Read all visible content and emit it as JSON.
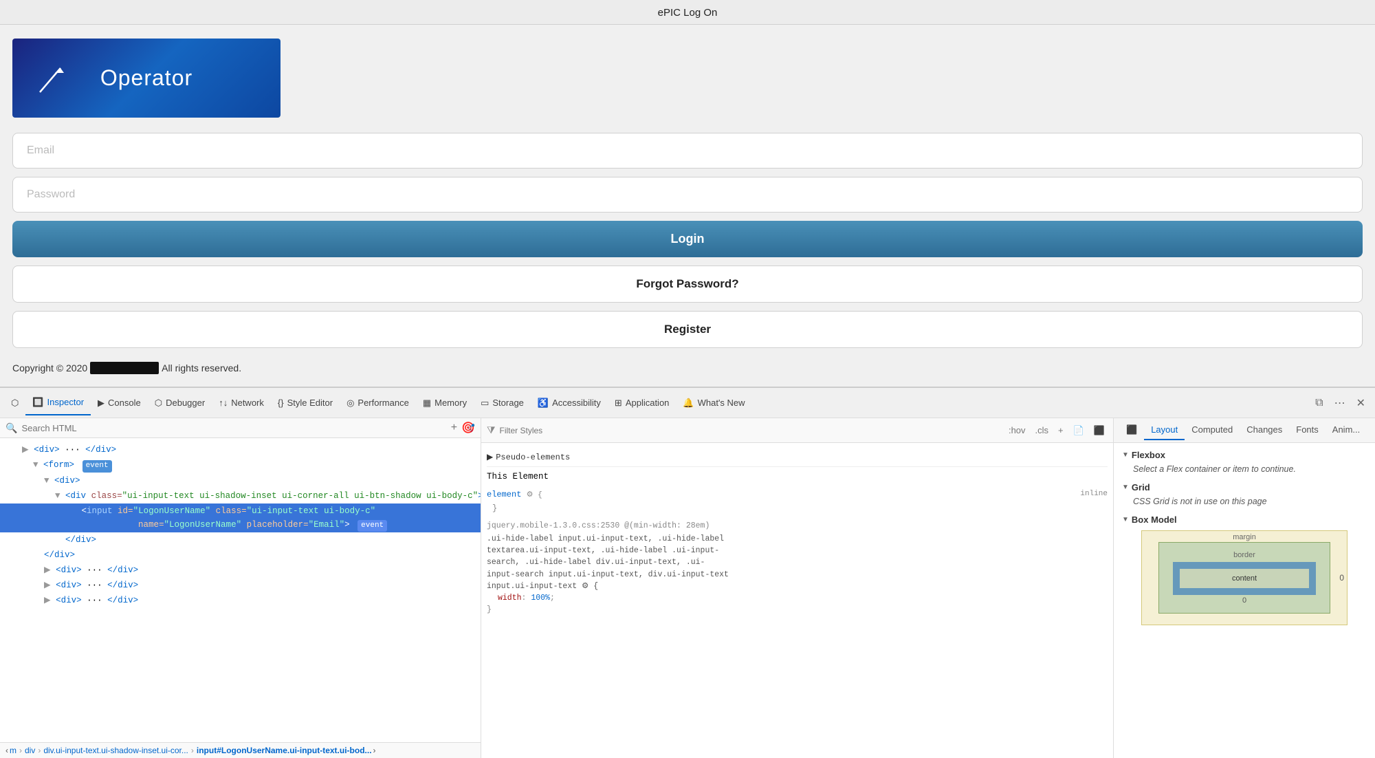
{
  "titleBar": {
    "title": "ePIC Log On"
  },
  "page": {
    "logo": {
      "text": "Operator"
    },
    "emailPlaceholder": "Email",
    "passwordPlaceholder": "Password",
    "loginButton": "Login",
    "forgotButton": "Forgot Password?",
    "registerButton": "Register",
    "copyright": "Copyright © 2020",
    "copyrightSuffix": "All rights reserved."
  },
  "devtools": {
    "tools": [
      {
        "id": "picker",
        "label": "",
        "icon": "⬡",
        "active": false
      },
      {
        "id": "inspector",
        "label": "Inspector",
        "icon": "🔲",
        "active": true
      },
      {
        "id": "console",
        "label": "Console",
        "icon": "▶",
        "active": false
      },
      {
        "id": "debugger",
        "label": "Debugger",
        "icon": "⬡",
        "active": false
      },
      {
        "id": "network",
        "label": "Network",
        "icon": "↑↓",
        "active": false
      },
      {
        "id": "style-editor",
        "label": "Style Editor",
        "icon": "{}",
        "active": false
      },
      {
        "id": "performance",
        "label": "Performance",
        "icon": "◎",
        "active": false
      },
      {
        "id": "memory",
        "label": "Memory",
        "icon": "▦",
        "active": false
      },
      {
        "id": "storage",
        "label": "Storage",
        "icon": "▭",
        "active": false
      },
      {
        "id": "accessibility",
        "label": "Accessibility",
        "icon": "♿",
        "active": false
      },
      {
        "id": "application",
        "label": "Application",
        "icon": "⊞",
        "active": false
      },
      {
        "id": "whats-new",
        "label": "What's New",
        "icon": "🔔",
        "active": false
      }
    ],
    "searchHtml": {
      "placeholder": "Search HTML"
    },
    "htmlCode": [
      {
        "indent": 4,
        "text": "▶ <div> ··· </div>",
        "selected": false
      },
      {
        "indent": 6,
        "text": "▼ <form>",
        "badge": "event",
        "selected": false
      },
      {
        "indent": 8,
        "text": "▼ <div>",
        "selected": false
      },
      {
        "indent": 10,
        "text": "▼ <div class=\"ui-input-text ui-shadow-inset ui-corner-all ui-btn-shadow ui-body-c\">",
        "selected": false
      },
      {
        "indent": 12,
        "text": "<input id=\"LogonUserName\" class=\"ui-input-text ui-body-c\"",
        "selected": true,
        "continuation": "name=\"LogonUserName\" placeholder=\"Email\">",
        "badge": "event"
      },
      {
        "indent": 12,
        "text": "</div>",
        "selected": false
      },
      {
        "indent": 10,
        "text": "</div>",
        "selected": false
      },
      {
        "indent": 8,
        "text": "▶ <div> ··· </div>",
        "selected": false
      },
      {
        "indent": 8,
        "text": "▶ <div> ··· </div>",
        "selected": false
      },
      {
        "indent": 8,
        "text": "▶ <div> ··· </div>",
        "selected": false
      }
    ],
    "breadcrumb": [
      "m",
      "div",
      "div.ui-input-text.ui-shadow-inset.ui-cor...",
      "input#LogonUserName.ui-input-text.ui-bod..."
    ],
    "cssPanel": {
      "filterPlaceholder": "Filter Styles",
      "pseudoElements": "Pseudo-elements",
      "thisElement": "This Element",
      "elementRule": "element",
      "inline": "inline",
      "cssSource": "jquery.mobile-1.3.0.css:2530 @(min-width: 28em)",
      "cssSelector": ".ui-hide-label input.ui-input-text, .ui-hide-label textarea.ui-input-text, .ui-hide-label .ui-input-search, .ui-hide-label div.ui-input-text, .ui-input-search input.ui-input-text, div.ui-input-text input.ui-input-text {",
      "cssProperty": "width",
      "cssValue": "100%"
    },
    "layoutPanel": {
      "tabs": [
        "Layout",
        "Computed",
        "Changes",
        "Fonts",
        "Anim..."
      ],
      "activeTab": "Layout",
      "sections": [
        {
          "title": "Flexbox",
          "body": "Select a Flex container or item to continue."
        },
        {
          "title": "Grid",
          "body": "CSS Grid is not in use on this page"
        },
        {
          "title": "Box Model",
          "body": ""
        }
      ],
      "boxModel": {
        "marginLabel": "margin",
        "marginValue": "0",
        "borderLabel": "border",
        "borderValue": "0"
      }
    }
  }
}
